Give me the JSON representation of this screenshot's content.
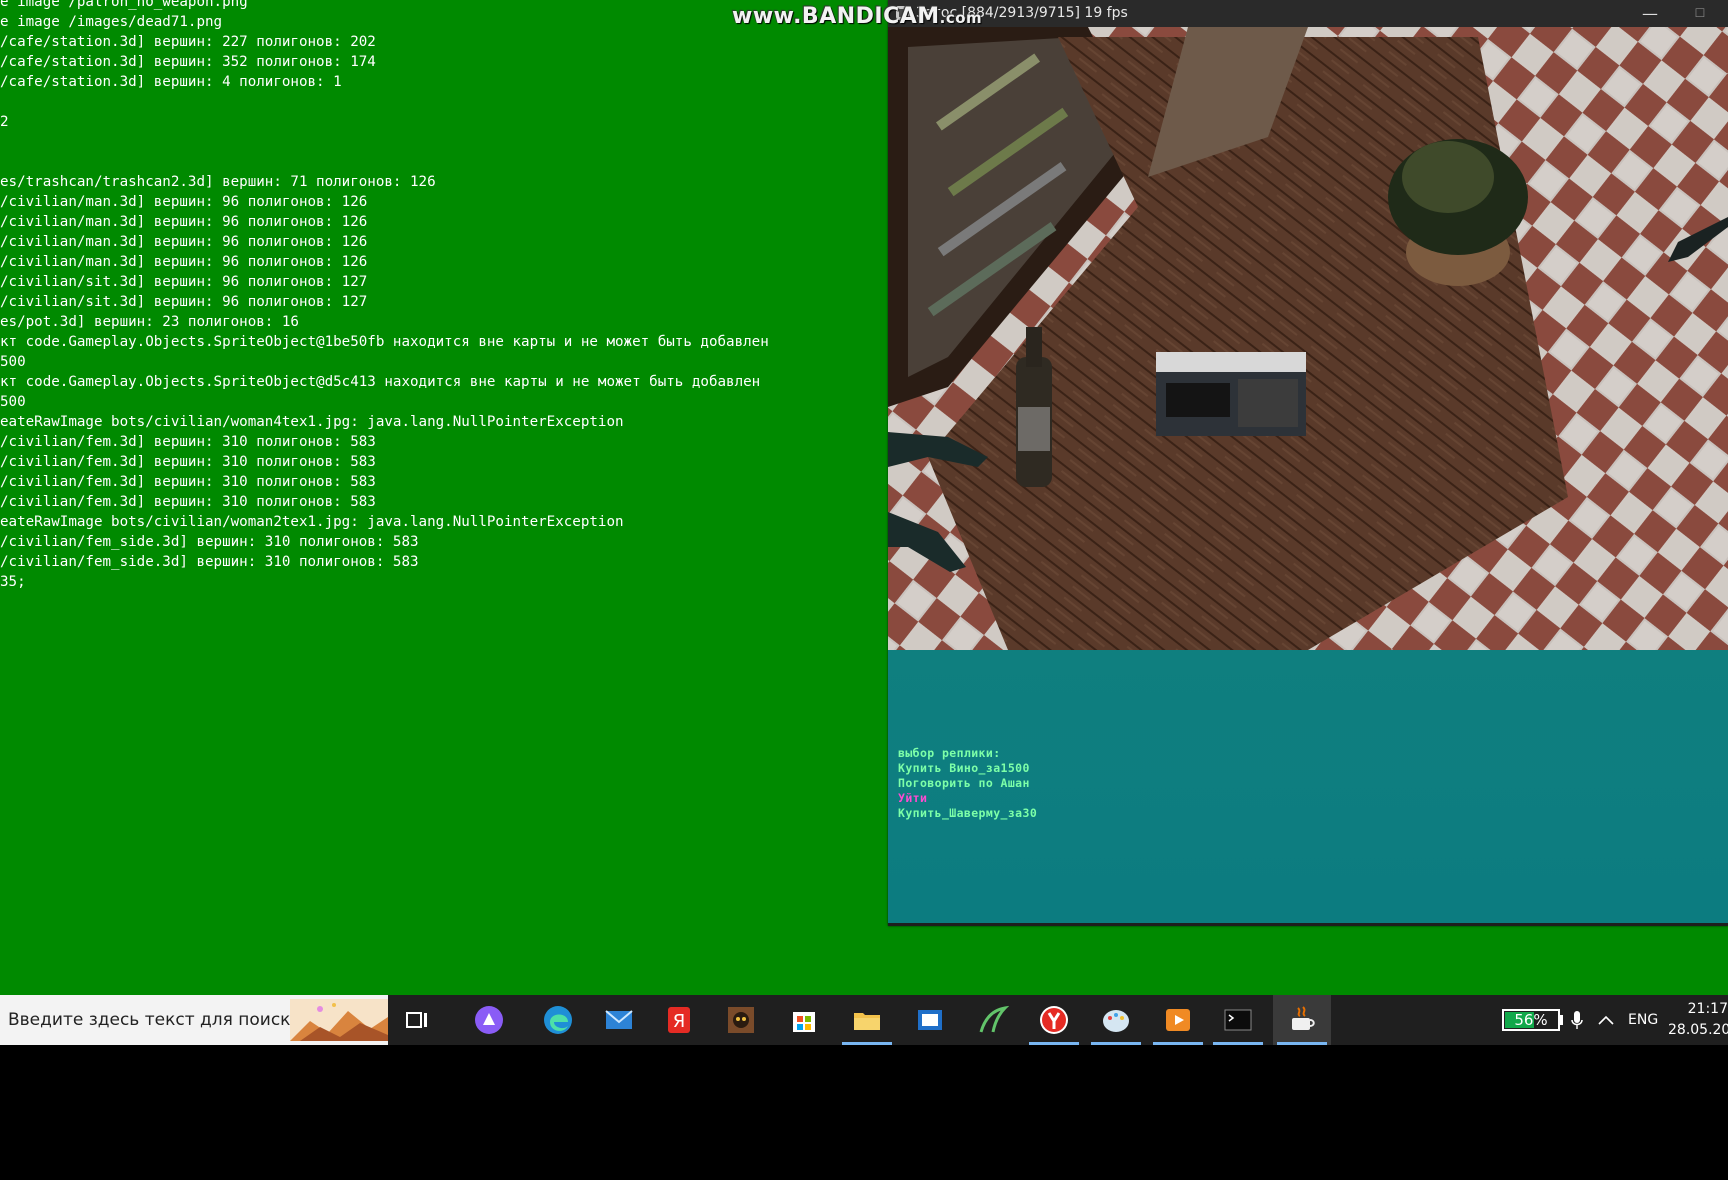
{
  "console": {
    "lines": [
      "e image /patron_no_weapon.png",
      "e image /images/dead71.png",
      "/cafe/station.3d] вершин: 227 полигонов: 202",
      "/cafe/station.3d] вершин: 352 полигонов: 174",
      "/cafe/station.3d] вершин: 4 полигонов: 1",
      "",
      "2",
      "",
      "",
      "es/trashcan/trashcan2.3d] вершин: 71 полигонов: 126",
      "/civilian/man.3d] вершин: 96 полигонов: 126",
      "/civilian/man.3d] вершин: 96 полигонов: 126",
      "/civilian/man.3d] вершин: 96 полигонов: 126",
      "/civilian/man.3d] вершин: 96 полигонов: 126",
      "/civilian/sit.3d] вершин: 96 полигонов: 127",
      "/civilian/sit.3d] вершин: 96 полигонов: 127",
      "es/pot.3d] вершин: 23 полигонов: 16",
      "кт code.Gameplay.Objects.SpriteObject@1be50fb находится вне карты и не может быть добавлен",
      "500",
      "кт code.Gameplay.Objects.SpriteObject@d5c413 находится вне карты и не может быть добавлен",
      "500",
      "eateRawImage bots/civilian/woman4tex1.jpg: java.lang.NullPointerException",
      "/civilian/fem.3d] вершин: 310 полигонов: 583",
      "/civilian/fem.3d] вершин: 310 полигонов: 583",
      "/civilian/fem.3d] вершин: 310 полигонов: 583",
      "/civilian/fem.3d] вершин: 310 полигонов: 583",
      "eateRawImage bots/civilian/woman2tex1.jpg: java.lang.NullPointerException",
      "/civilian/fem_side.3d] вершин: 310 полигонов: 583",
      "/civilian/fem_side.3d] вершин: 310 полигонов: 583",
      "35;"
    ]
  },
  "game_window": {
    "title": "Загос [884/2913/9715] 19 fps",
    "minimize_glyph": "—",
    "maximize_glyph": "☐"
  },
  "watermark": {
    "main": "www.BANDICAM",
    "suffix": ".com"
  },
  "dialog": {
    "header": "выбор реплики:",
    "options": [
      {
        "text": "Купить Вино_за1500",
        "color": "#7dffa8"
      },
      {
        "text": "Поговорить по Ашан",
        "color": "#7dffa8"
      },
      {
        "text": "Уйти",
        "color": "#ff4bd2"
      },
      {
        "text": "Купить_Шаверму_за30",
        "color": "#7dffa8"
      }
    ],
    "header_color": "#7dffa8"
  },
  "taskbar": {
    "search_placeholder": "Введите здесь текст для поиска",
    "icons": [
      "task-view-icon",
      "alice-icon",
      "edge-icon",
      "mail-icon",
      "yandex-icon",
      "game-avatar-icon",
      "store-icon",
      "file-explorer-icon",
      "word-pad-icon",
      "app-leaf-icon",
      "yandex-browser-icon",
      "paint-icon",
      "media-player-icon",
      "terminal-icon",
      "java-icon"
    ],
    "battery": "56%",
    "battery_level": 0.56,
    "language": "ENG",
    "time": "21:17",
    "date": "28.05.20"
  }
}
